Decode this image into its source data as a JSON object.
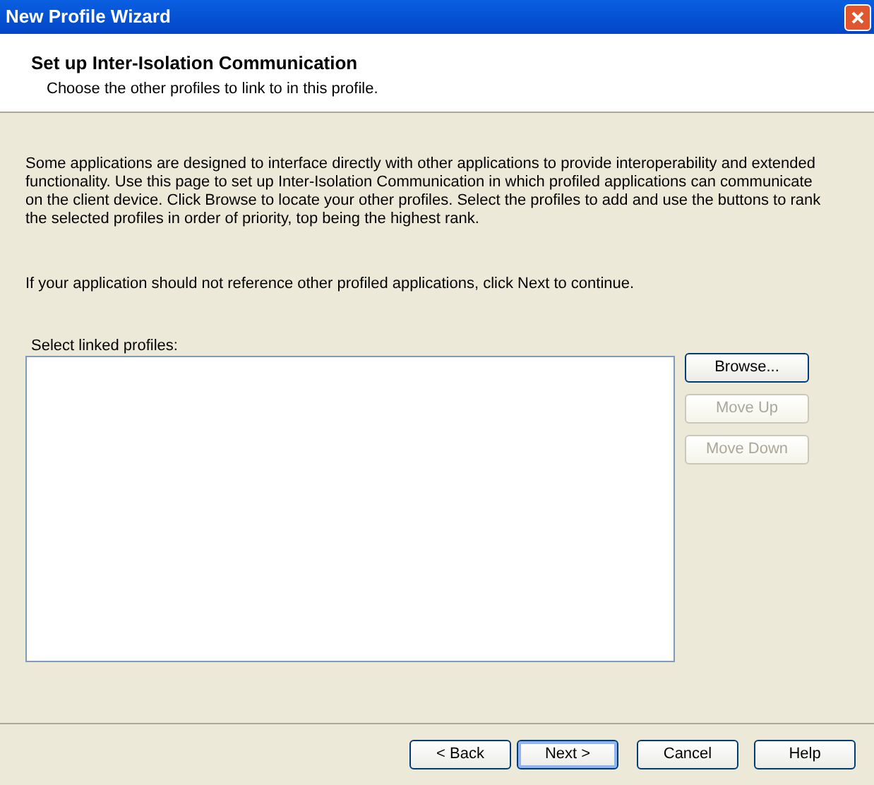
{
  "window": {
    "title": "New Profile Wizard"
  },
  "header": {
    "title": "Set up Inter-Isolation Communication",
    "subtitle": "Choose the other profiles to link to in this profile."
  },
  "paragraphs": [
    "Some applications are designed to interface directly with other applications to provide interoperability and extended functionality. Use this page to set up Inter-Isolation Communication in which profiled applications can communicate on the client device. Click Browse to locate your other profiles. Select the profiles to add and use the buttons to rank the selected profiles in order of priority, top being the highest rank.",
    "If your application should not reference other profiled applications, click Next to continue."
  ],
  "list": {
    "label": "Select linked profiles:"
  },
  "side_buttons": [
    {
      "label": "Browse...",
      "disabled": false
    },
    {
      "label": "Move Up",
      "disabled": true
    },
    {
      "label": "Move Down",
      "disabled": true
    }
  ],
  "footer_buttons": [
    {
      "label": "< Back",
      "default": false
    },
    {
      "label": "Next >",
      "default": true
    },
    {
      "label": "Cancel",
      "default": false
    },
    {
      "label": "Help",
      "default": false
    }
  ]
}
